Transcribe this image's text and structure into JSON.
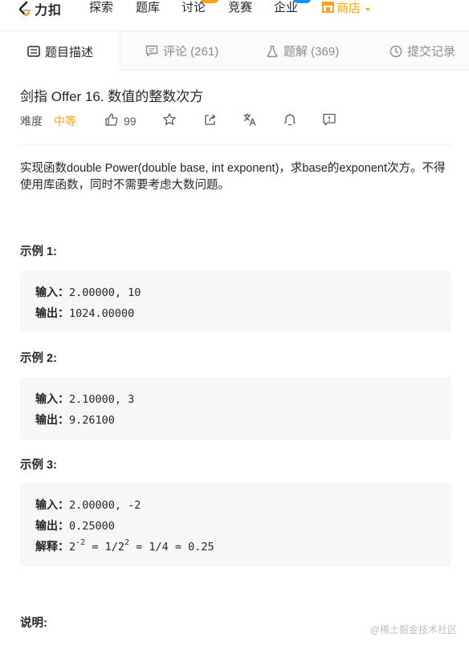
{
  "nav": {
    "logo_text": "力扣",
    "items": [
      "探索",
      "题库",
      "讨论",
      "竞赛",
      "企业"
    ],
    "shop_label": "商店",
    "badge_colors": {
      "discuss": "#ffa116",
      "enterprise": "#1890ff"
    }
  },
  "tabs": [
    {
      "label": "题目描述",
      "icon": "description-icon"
    },
    {
      "label": "评论 (261)",
      "icon": "comment-icon"
    },
    {
      "label": "题解 (369)",
      "icon": "flask-icon"
    },
    {
      "label": "提交记录",
      "icon": "clock-icon"
    }
  ],
  "problem": {
    "title": "剑指 Offer 16. 数值的整数次方",
    "difficulty_label": "难度",
    "difficulty": "中等",
    "likes": "99",
    "description": "实现函数double Power(double base, int exponent)，求base的exponent次方。不得使用库函数，同时不需要考虑大数问题。"
  },
  "examples": [
    {
      "title": "示例 1:",
      "input_label": "输入：",
      "input": "2.00000, 10",
      "output_label": "输出：",
      "output": "1024.00000"
    },
    {
      "title": "示例 2:",
      "input_label": "输入：",
      "input": "2.10000, 3",
      "output_label": "输出：",
      "output": "9.26100"
    },
    {
      "title": "示例 3:",
      "input_label": "输入：",
      "input": "2.00000, -2",
      "output_label": "输出：",
      "output": "0.25000",
      "explain_label": "解释：",
      "explain_base": "2",
      "explain_exp": "-2",
      "explain_mid": " = 1/2",
      "explain_exp2": "2",
      "explain_end": " = 1/4 = 0.25"
    }
  ],
  "notes_title": "说明:",
  "watermark": "@稀土掘金技术社区",
  "colors": {
    "accent": "#ffa116",
    "text": "#262626",
    "muted": "#8c8c8c",
    "code_bg": "#f7f7f7"
  }
}
